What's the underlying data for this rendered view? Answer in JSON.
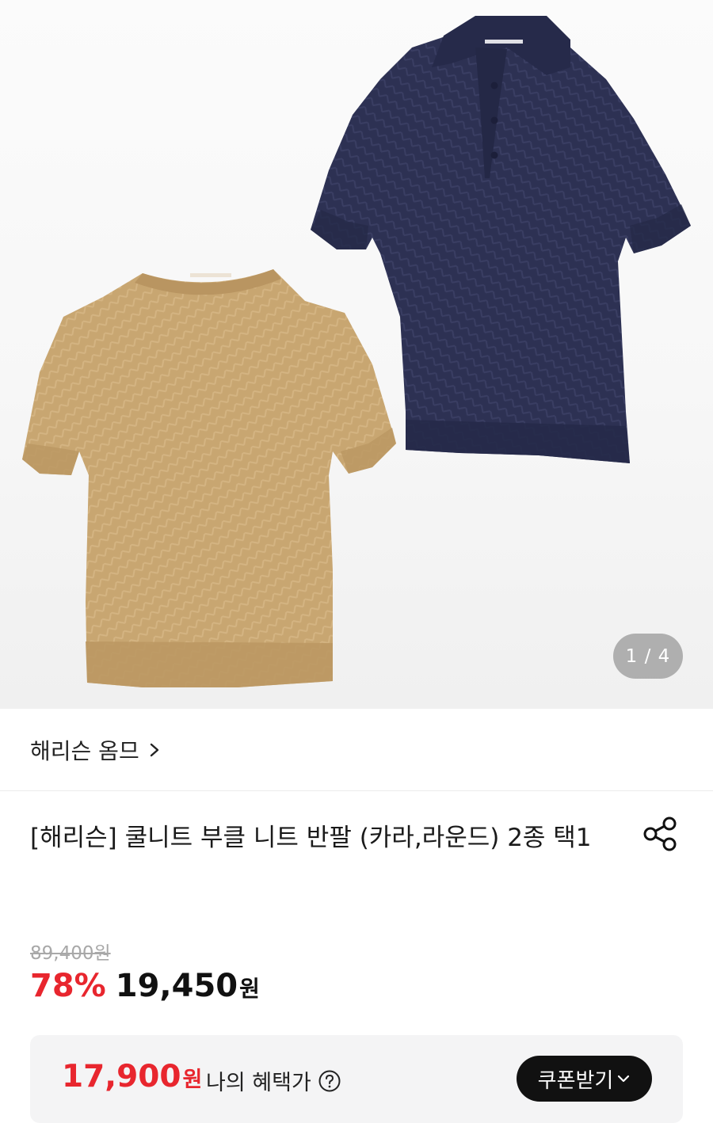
{
  "gallery": {
    "page_indicator": "1 / 4",
    "image": {
      "description_icon": "product-photo",
      "colors": {
        "beige_knit": "#c7a56f",
        "navy_knit": "#2c2f52",
        "background": "#f6f6f6"
      }
    }
  },
  "brand": {
    "name": "해리슨 옴므"
  },
  "product": {
    "title": "[해리슨] 쿨니트 부클 니트 반팔 (카라,라운드) 2종 택1"
  },
  "price": {
    "original": "89,400원",
    "discount": "78%",
    "sale": "19,450",
    "currency": "원"
  },
  "benefit": {
    "amount": "17,900",
    "currency": "원",
    "label": "나의 혜택가",
    "coupon_button": "쿠폰받기"
  },
  "colors": {
    "accent_red": "#e8262e",
    "button_dark": "#111111",
    "benefit_bg": "#f4f4f5"
  }
}
